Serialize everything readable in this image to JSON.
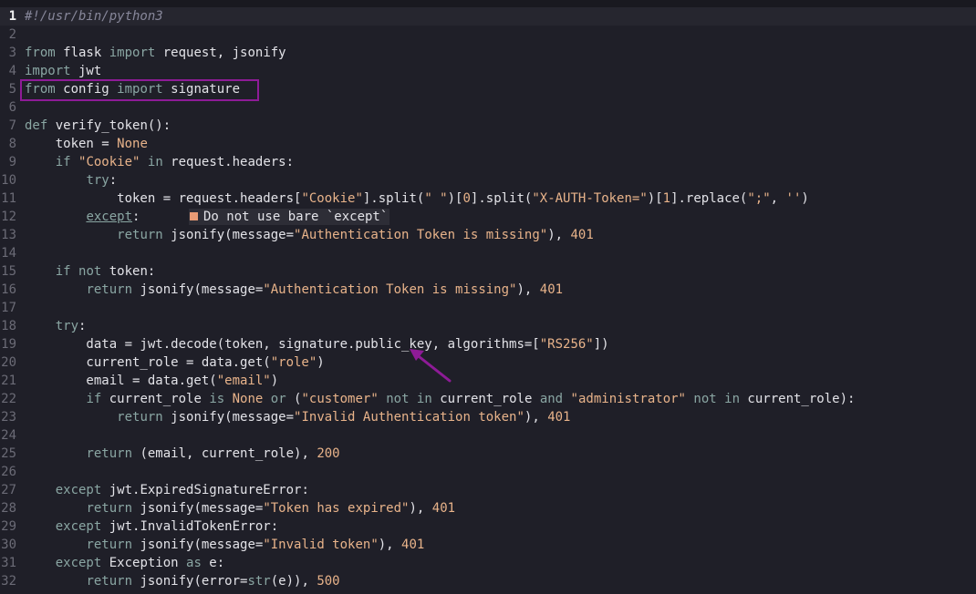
{
  "editor": {
    "current_line": 1,
    "lines": [
      [
        {
          "t": "#!/usr/bin/python3",
          "c": "cm"
        }
      ],
      [],
      [
        {
          "t": "from",
          "c": "kw"
        },
        {
          "t": " flask ",
          "c": "bi"
        },
        {
          "t": "import",
          "c": "kw"
        },
        {
          "t": " request, jsonify",
          "c": "bi"
        }
      ],
      [
        {
          "t": "import",
          "c": "kw"
        },
        {
          "t": " jwt",
          "c": "bi"
        }
      ],
      [
        {
          "t": "from",
          "c": "kw"
        },
        {
          "t": " config ",
          "c": "bi"
        },
        {
          "t": "import",
          "c": "kw"
        },
        {
          "t": " signature",
          "c": "bi"
        }
      ],
      [],
      [
        {
          "t": "def",
          "c": "kw"
        },
        {
          "t": " verify_token():",
          "c": "bi"
        }
      ],
      [
        {
          "t": "    token = ",
          "c": "bi"
        },
        {
          "t": "None",
          "c": "num"
        }
      ],
      [
        {
          "t": "    ",
          "c": "bi"
        },
        {
          "t": "if",
          "c": "kw"
        },
        {
          "t": " ",
          "c": "bi"
        },
        {
          "t": "\"Cookie\"",
          "c": "str"
        },
        {
          "t": " ",
          "c": "bi"
        },
        {
          "t": "in",
          "c": "kw"
        },
        {
          "t": " request.headers:",
          "c": "bi"
        }
      ],
      [
        {
          "t": "        ",
          "c": "bi"
        },
        {
          "t": "try",
          "c": "kw"
        },
        {
          "t": ":",
          "c": "bi"
        }
      ],
      [
        {
          "t": "            token = request.headers[",
          "c": "bi"
        },
        {
          "t": "\"Cookie\"",
          "c": "str"
        },
        {
          "t": "].split(",
          "c": "bi"
        },
        {
          "t": "\" \"",
          "c": "str"
        },
        {
          "t": ")[",
          "c": "bi"
        },
        {
          "t": "0",
          "c": "num"
        },
        {
          "t": "].split(",
          "c": "bi"
        },
        {
          "t": "\"X-AUTH-Token=\"",
          "c": "str"
        },
        {
          "t": ")[",
          "c": "bi"
        },
        {
          "t": "1",
          "c": "num"
        },
        {
          "t": "].replace(",
          "c": "bi"
        },
        {
          "t": "\";\"",
          "c": "str"
        },
        {
          "t": ", ",
          "c": "bi"
        },
        {
          "t": "''",
          "c": "str"
        },
        {
          "t": ")",
          "c": "bi"
        }
      ],
      [
        {
          "t": "        ",
          "c": "bi"
        },
        {
          "t": "except",
          "c": "kw und"
        },
        {
          "t": ":",
          "c": "bi"
        }
      ],
      [
        {
          "t": "            ",
          "c": "bi"
        },
        {
          "t": "return",
          "c": "kw"
        },
        {
          "t": " jsonify(message=",
          "c": "bi"
        },
        {
          "t": "\"Authentication Token is missing\"",
          "c": "str"
        },
        {
          "t": "), ",
          "c": "bi"
        },
        {
          "t": "401",
          "c": "num"
        }
      ],
      [],
      [
        {
          "t": "    ",
          "c": "bi"
        },
        {
          "t": "if",
          "c": "kw"
        },
        {
          "t": " ",
          "c": "bi"
        },
        {
          "t": "not",
          "c": "kw"
        },
        {
          "t": " token:",
          "c": "bi"
        }
      ],
      [
        {
          "t": "        ",
          "c": "bi"
        },
        {
          "t": "return",
          "c": "kw"
        },
        {
          "t": " jsonify(message=",
          "c": "bi"
        },
        {
          "t": "\"Authentication Token is missing\"",
          "c": "str"
        },
        {
          "t": "), ",
          "c": "bi"
        },
        {
          "t": "401",
          "c": "num"
        }
      ],
      [],
      [
        {
          "t": "    ",
          "c": "bi"
        },
        {
          "t": "try",
          "c": "kw"
        },
        {
          "t": ":",
          "c": "bi"
        }
      ],
      [
        {
          "t": "        data = jwt.decode(token, signature.public_key, algorithms=[",
          "c": "bi"
        },
        {
          "t": "\"RS256\"",
          "c": "str"
        },
        {
          "t": "])",
          "c": "bi"
        }
      ],
      [
        {
          "t": "        current_role = data.get(",
          "c": "bi"
        },
        {
          "t": "\"role\"",
          "c": "str"
        },
        {
          "t": ")",
          "c": "bi"
        }
      ],
      [
        {
          "t": "        email = data.get(",
          "c": "bi"
        },
        {
          "t": "\"email\"",
          "c": "str"
        },
        {
          "t": ")",
          "c": "bi"
        }
      ],
      [
        {
          "t": "        ",
          "c": "bi"
        },
        {
          "t": "if",
          "c": "kw"
        },
        {
          "t": " current_role ",
          "c": "bi"
        },
        {
          "t": "is",
          "c": "kw"
        },
        {
          "t": " ",
          "c": "bi"
        },
        {
          "t": "None",
          "c": "num"
        },
        {
          "t": " ",
          "c": "bi"
        },
        {
          "t": "or",
          "c": "kw"
        },
        {
          "t": " (",
          "c": "bi"
        },
        {
          "t": "\"customer\"",
          "c": "str"
        },
        {
          "t": " ",
          "c": "bi"
        },
        {
          "t": "not in",
          "c": "kw"
        },
        {
          "t": " current_role ",
          "c": "bi"
        },
        {
          "t": "and",
          "c": "kw"
        },
        {
          "t": " ",
          "c": "bi"
        },
        {
          "t": "\"administrator\"",
          "c": "str"
        },
        {
          "t": " ",
          "c": "bi"
        },
        {
          "t": "not in",
          "c": "kw"
        },
        {
          "t": " current_role):",
          "c": "bi"
        }
      ],
      [
        {
          "t": "            ",
          "c": "bi"
        },
        {
          "t": "return",
          "c": "kw"
        },
        {
          "t": " jsonify(message=",
          "c": "bi"
        },
        {
          "t": "\"Invalid Authentication token\"",
          "c": "str"
        },
        {
          "t": "), ",
          "c": "bi"
        },
        {
          "t": "401",
          "c": "num"
        }
      ],
      [],
      [
        {
          "t": "        ",
          "c": "bi"
        },
        {
          "t": "return",
          "c": "kw"
        },
        {
          "t": " (email, current_role), ",
          "c": "bi"
        },
        {
          "t": "200",
          "c": "num"
        }
      ],
      [],
      [
        {
          "t": "    ",
          "c": "bi"
        },
        {
          "t": "except",
          "c": "kw"
        },
        {
          "t": " jwt.ExpiredSignatureError:",
          "c": "bi"
        }
      ],
      [
        {
          "t": "        ",
          "c": "bi"
        },
        {
          "t": "return",
          "c": "kw"
        },
        {
          "t": " jsonify(message=",
          "c": "bi"
        },
        {
          "t": "\"Token has expired\"",
          "c": "str"
        },
        {
          "t": "), ",
          "c": "bi"
        },
        {
          "t": "401",
          "c": "num"
        }
      ],
      [
        {
          "t": "    ",
          "c": "bi"
        },
        {
          "t": "except",
          "c": "kw"
        },
        {
          "t": " jwt.InvalidTokenError:",
          "c": "bi"
        }
      ],
      [
        {
          "t": "        ",
          "c": "bi"
        },
        {
          "t": "return",
          "c": "kw"
        },
        {
          "t": " jsonify(message=",
          "c": "bi"
        },
        {
          "t": "\"Invalid token\"",
          "c": "str"
        },
        {
          "t": "), ",
          "c": "bi"
        },
        {
          "t": "401",
          "c": "num"
        }
      ],
      [
        {
          "t": "    ",
          "c": "bi"
        },
        {
          "t": "except",
          "c": "kw"
        },
        {
          "t": " Exception ",
          "c": "bi"
        },
        {
          "t": "as",
          "c": "kw"
        },
        {
          "t": " e:",
          "c": "bi"
        }
      ],
      [
        {
          "t": "        ",
          "c": "bi"
        },
        {
          "t": "return",
          "c": "kw"
        },
        {
          "t": " jsonify(error=",
          "c": "bi"
        },
        {
          "t": "str",
          "c": "kw"
        },
        {
          "t": "(e)), ",
          "c": "bi"
        },
        {
          "t": "500",
          "c": "num"
        }
      ]
    ],
    "diagnostic": {
      "line": 12,
      "message": "Do not use bare `except`",
      "severity_color": "#e99b75"
    },
    "annotations": {
      "box_color": "#8e1b97",
      "arrow_color": "#8e1b97"
    }
  }
}
